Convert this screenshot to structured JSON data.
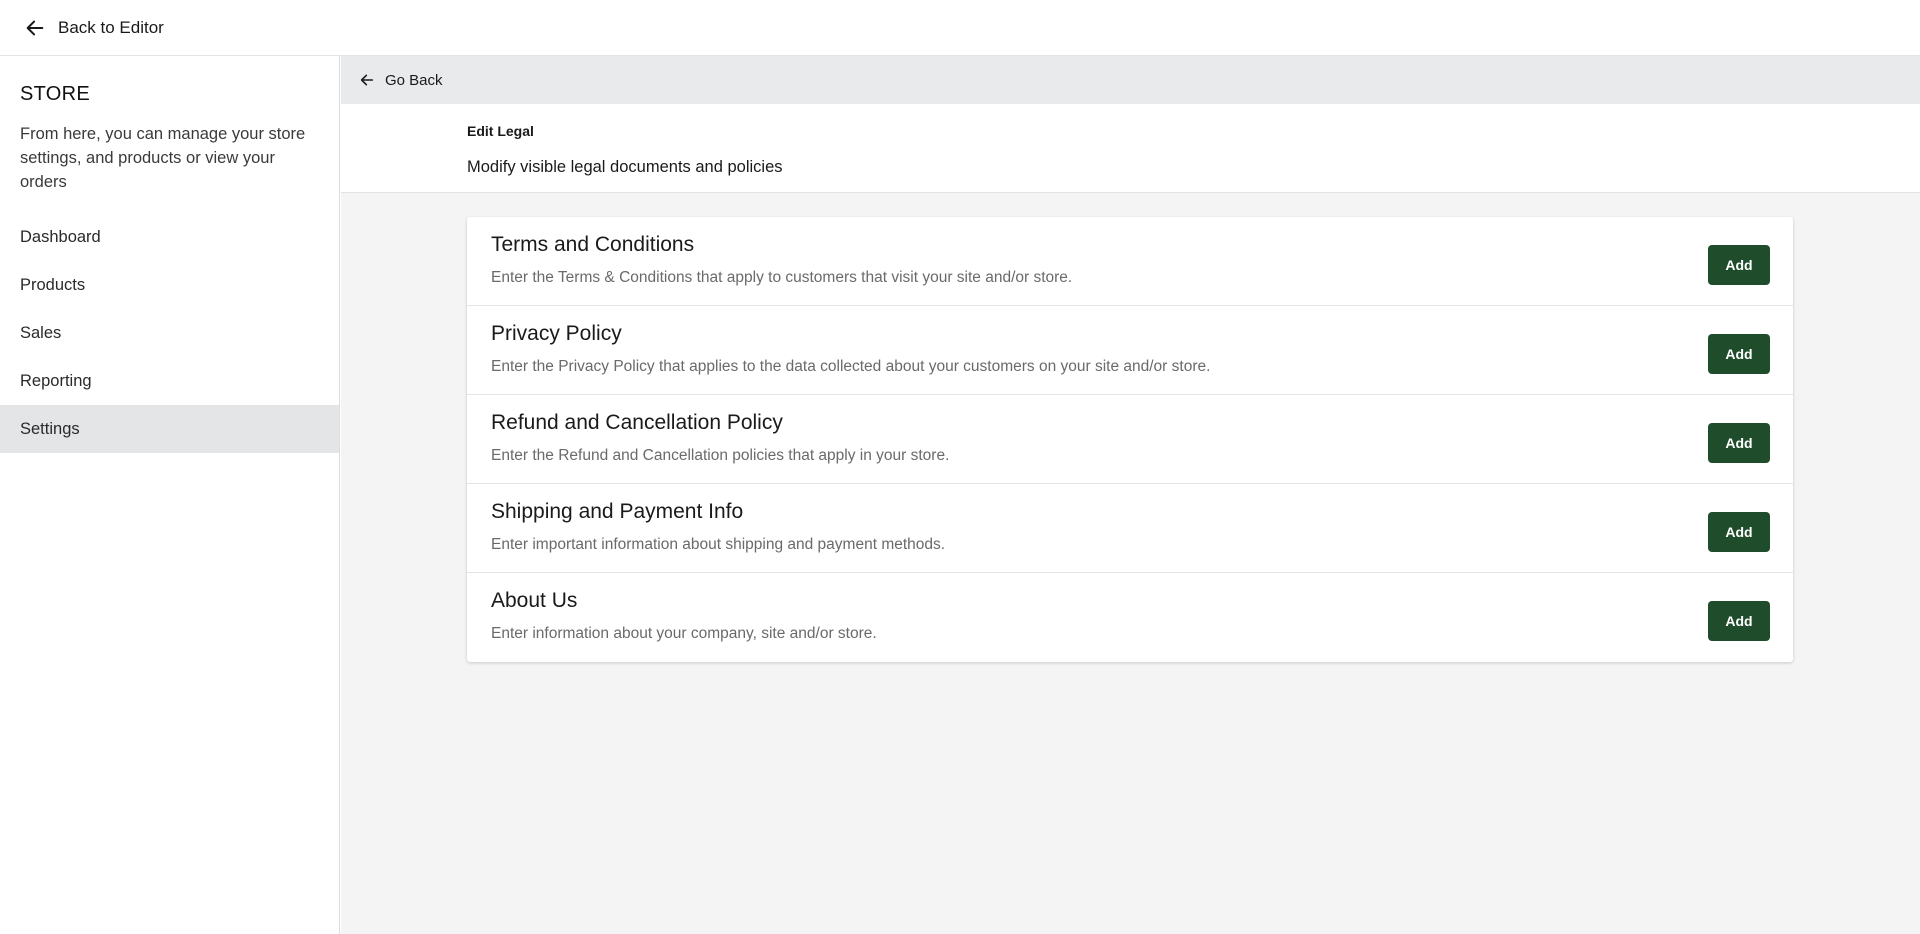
{
  "topbar": {
    "back_label": "Back to Editor",
    "back_icon": "arrow-left-icon"
  },
  "sidebar": {
    "title": "STORE",
    "description": "From here, you can manage your store settings, and products or view your orders",
    "items": [
      {
        "label": "Dashboard",
        "active": false
      },
      {
        "label": "Products",
        "active": false
      },
      {
        "label": "Sales",
        "active": false
      },
      {
        "label": "Reporting",
        "active": false
      },
      {
        "label": "Settings",
        "active": true
      }
    ]
  },
  "main": {
    "go_back_label": "Go Back",
    "edit_title": "Edit Legal",
    "edit_subtitle": "Modify visible legal documents and policies",
    "documents": [
      {
        "title": "Terms and Conditions",
        "description": "Enter the Terms & Conditions that apply to customers that visit your site and/or store.",
        "button": "Add"
      },
      {
        "title": "Privacy Policy",
        "description": "Enter the Privacy Policy that applies to the data collected about your customers on your site and/or store.",
        "button": "Add"
      },
      {
        "title": "Refund and Cancellation Policy",
        "description": "Enter the Refund and Cancellation policies that apply in your store.",
        "button": "Add"
      },
      {
        "title": "Shipping and Payment Info",
        "description": "Enter important information about shipping and payment methods.",
        "button": "Add"
      },
      {
        "title": "About Us",
        "description": "Enter information about your company, site and/or store.",
        "button": "Add"
      }
    ]
  },
  "colors": {
    "accent_button": "#1f4d2b",
    "active_nav": "#e4e5e7",
    "main_bg": "#f4f4f4"
  }
}
